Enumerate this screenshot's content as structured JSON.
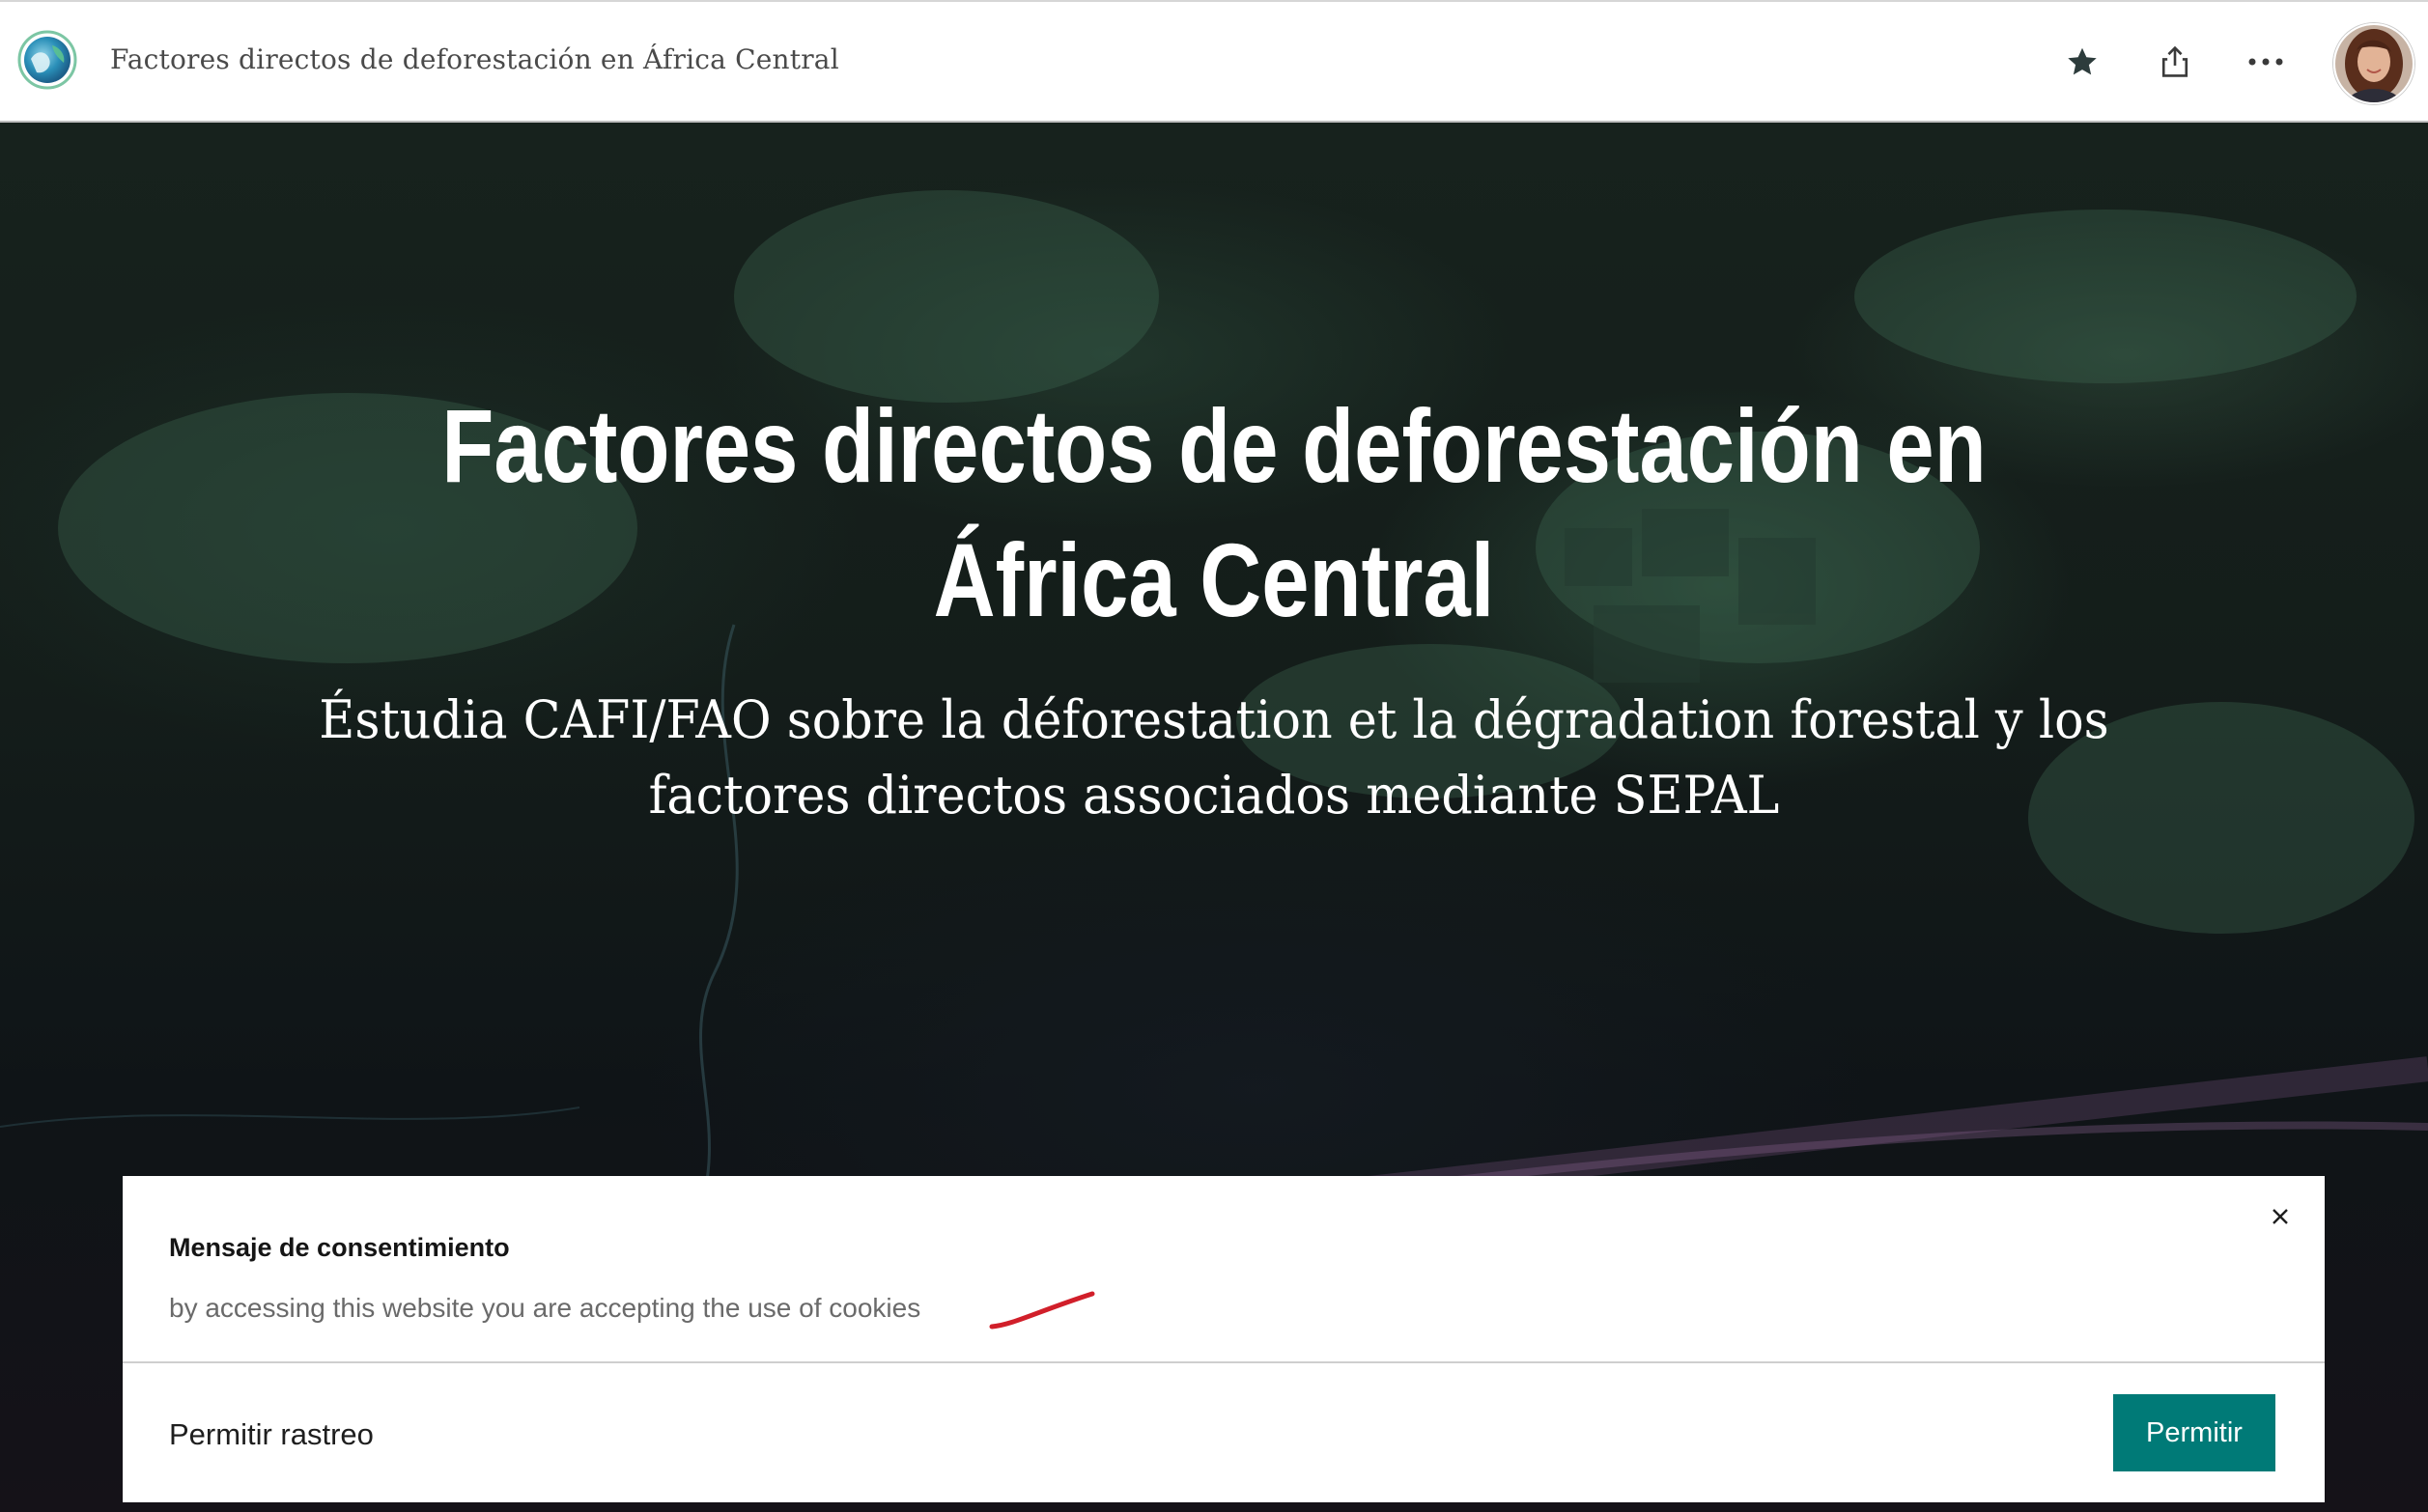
{
  "header": {
    "title": "Factores directos de deforestación en África Central",
    "logo_icon": "globe-logo-icon",
    "favorite_icon": "star-icon",
    "share_icon": "share-icon",
    "more_icon": "more-horizontal-icon",
    "avatar": "user-avatar"
  },
  "hero": {
    "title": "Factores directos de deforestación en África Central",
    "subtitle": "Éstudia CAFI/FAO sobre la déforestation et la dégradation forestal y los factores directos associados mediante SEPAL"
  },
  "consent": {
    "title": "Mensaje de consentimiento",
    "message": "by accessing this website you are accepting the use of cookies",
    "close_icon": "close-icon",
    "allow_tracking_label": "Permitir rastreo",
    "allow_button_label": "Permitir"
  },
  "colors": {
    "accent": "#007a77",
    "header_bg": "#ffffff",
    "annotation_red": "#d11f2a"
  }
}
